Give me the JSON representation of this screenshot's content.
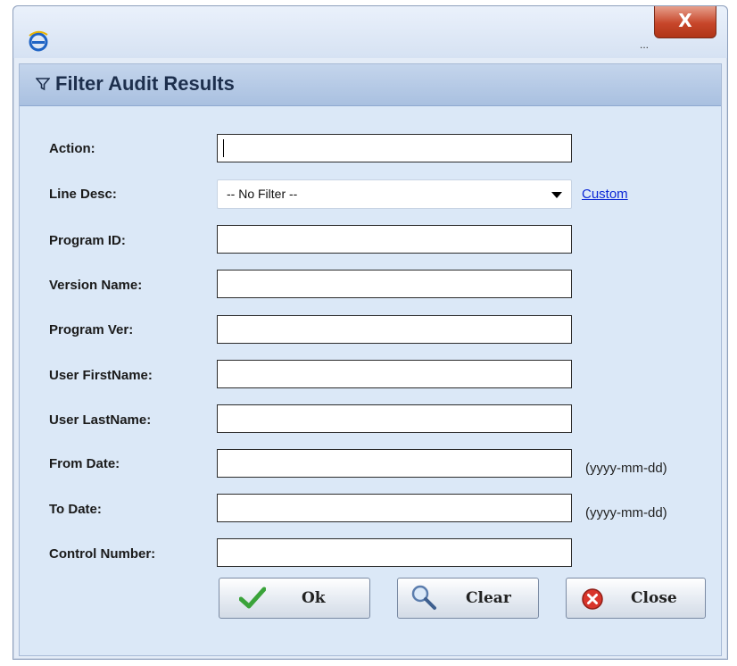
{
  "window": {
    "title_ellipsis": "...",
    "close_glyph": "X",
    "icons": {
      "app": "ie-icon",
      "close": "close-icon"
    }
  },
  "panel": {
    "title": "Filter Audit Results",
    "icon": "funnel-icon"
  },
  "form": {
    "action": {
      "label": "Action:",
      "value": ""
    },
    "line_desc": {
      "label": "Line Desc:",
      "selected": "-- No Filter --",
      "link": "Custom"
    },
    "program_id": {
      "label": "Program ID:",
      "value": ""
    },
    "version_name": {
      "label": "Version Name:",
      "value": ""
    },
    "program_ver": {
      "label": "Program Ver:",
      "value": ""
    },
    "user_firstname": {
      "label": "User FirstName:",
      "value": ""
    },
    "user_lastname": {
      "label": "User LastName:",
      "value": ""
    },
    "from_date": {
      "label": "From Date:",
      "value": "",
      "hint": "(yyyy-mm-dd)"
    },
    "to_date": {
      "label": "To Date:",
      "value": "",
      "hint": "(yyyy-mm-dd)"
    },
    "control_number": {
      "label": "Control Number:",
      "value": ""
    }
  },
  "buttons": {
    "ok": {
      "label": "Ok",
      "icon": "checkmark-icon",
      "color": "#3aa33a"
    },
    "clear": {
      "label": "Clear",
      "icon": "magnifier-icon"
    },
    "close": {
      "label": "Close",
      "icon": "close-circle-icon",
      "color": "#d9352b"
    }
  }
}
